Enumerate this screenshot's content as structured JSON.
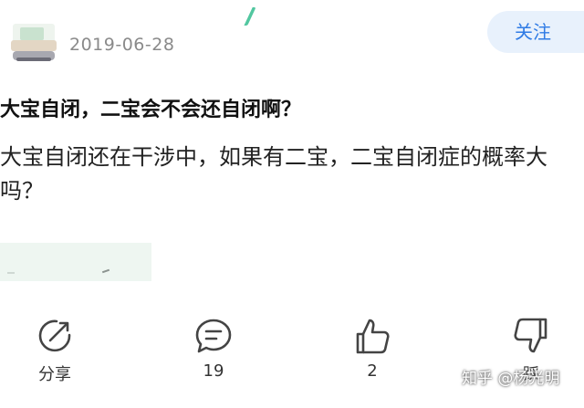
{
  "post": {
    "date": "2019-06-28",
    "follow_label": "关注",
    "title": "大宝自闭，二宝会不会还自闭啊？",
    "body": "大宝自闭还在干涉中，如果有二宝，二宝自闭症的概率大吗？"
  },
  "actions": {
    "share": {
      "icon": "share-icon",
      "label": "分享"
    },
    "comment": {
      "icon": "comment-icon",
      "count": "19"
    },
    "like": {
      "icon": "thumbs-up-icon",
      "count": "2"
    },
    "dislike": {
      "icon": "thumbs-down-icon",
      "label": "踩"
    }
  },
  "watermark": "知乎 @杨光明",
  "colors": {
    "follow_text": "#2f7be5",
    "follow_bg": "#e8f1fc",
    "accent_dash": "#52c7a0"
  }
}
